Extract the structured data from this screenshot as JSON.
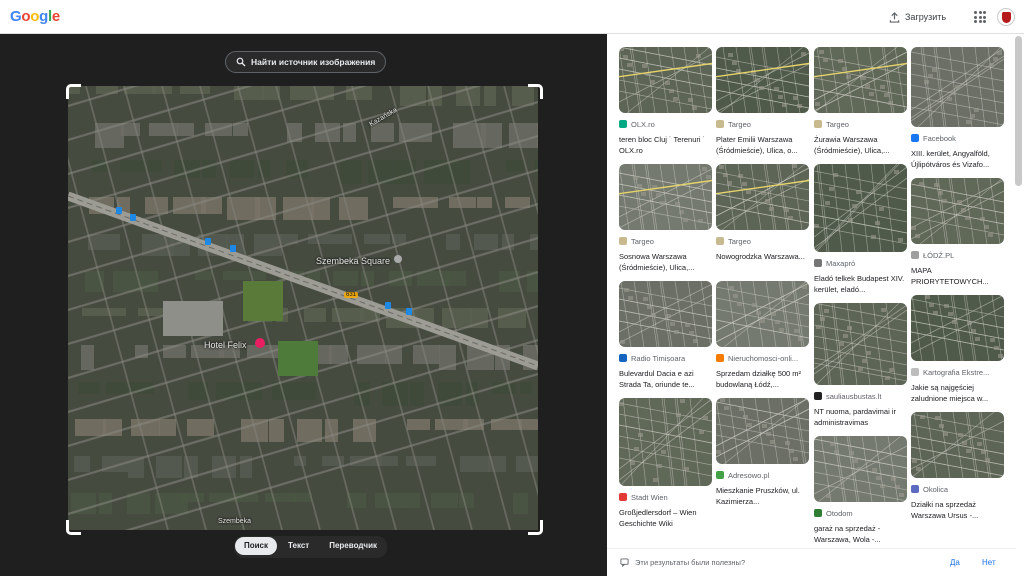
{
  "header": {
    "logo": "Google",
    "logo_colors": [
      "#4285F4",
      "#EA4335",
      "#FBBC05",
      "#4285F4",
      "#34A853",
      "#EA4335"
    ],
    "upload_label": "Загрузить",
    "upload_icon": "upload-icon",
    "apps_icon": "apps-grid-icon",
    "avatar_icon": "account-avatar"
  },
  "lens": {
    "find_source_label": "Найти источник изображения",
    "map_labels": {
      "street_top": "Kazańska",
      "square": "Szembeka Square",
      "hotel": "Hotel Felix",
      "road_sign": "631",
      "bottom": "Szembeka"
    },
    "tabs": [
      {
        "label": "Поиск",
        "active": true
      },
      {
        "label": "Текст",
        "active": false
      },
      {
        "label": "Переводчик",
        "active": false
      }
    ]
  },
  "results": {
    "columns": [
      [
        {
          "source": "OLX.ro",
          "title": "teren bloc Cluj ˙ Terenuri ˙ OLX.ro",
          "fav": "#00a884"
        },
        {
          "source": "Targeo",
          "title": "Sosnowa Warszawa (Śródmieście), Ulica,...",
          "fav": "#c8b98e"
        },
        {
          "source": "Radio Timișoara",
          "title": "Bulevardul Dacia e azi Strada Ta, oriunde te...",
          "fav": "#1565c0"
        },
        {
          "source": "Stadt Wien",
          "title": "Großjedlersdorf – Wien Geschichte Wiki",
          "fav": "#e53935"
        }
      ],
      [
        {
          "source": "Targeo",
          "title": "Plater Emilii Warszawa (Śródmieście), Ulica, o...",
          "fav": "#c8b98e"
        },
        {
          "source": "Targeo",
          "title": "Nowogrodzka Warszawa...",
          "fav": "#c8b98e"
        },
        {
          "source": "Nieruchomosci-onli...",
          "title": "Sprzedam działkę 500 m² budowlaną Łódź,...",
          "fav": "#f57c00"
        },
        {
          "source": "Adresowo.pl",
          "title": "Mieszkanie Pruszków, ul. Kazimierza...",
          "fav": "#43a047"
        }
      ],
      [
        {
          "source": "Targeo",
          "title": "Żurawia Warszawa (Śródmieście), Ulica,...",
          "fav": "#c8b98e"
        },
        {
          "source": "Maxapró",
          "title": "Eladó telkek Budapest XIV. kerület, eladó...",
          "fav": "#757575"
        },
        {
          "source": "sauliausbustas.lt",
          "title": "NT nuoma, pardavimai ir administravimas",
          "fav": "#212121"
        },
        {
          "source": "Otodom",
          "title": "garaż na sprzedaż - Warszawa, Wola -...",
          "fav": "#2e7d32"
        }
      ],
      [
        {
          "source": "Facebook",
          "title": "XIII. kerület, Angyalföld, Újlipótváros és Vizafo...",
          "fav": "#1877f2"
        },
        {
          "source": "ŁÓDŹ.PL",
          "title": "MAPA PRIORYTETOWYCH...",
          "fav": "#9e9e9e"
        },
        {
          "source": "Kartografia Ekstre...",
          "title": "Jakie są najgęściej zaludnione miejsca w...",
          "fav": "#bdbdbd"
        },
        {
          "source": "Okolica",
          "title": "Działki na sprzedaż Warszawa Ursus -...",
          "fav": "#5c6bc0"
        }
      ]
    ]
  },
  "feedback": {
    "question": "Эти результаты были полезны?",
    "yes": "Да",
    "no": "Нет"
  }
}
